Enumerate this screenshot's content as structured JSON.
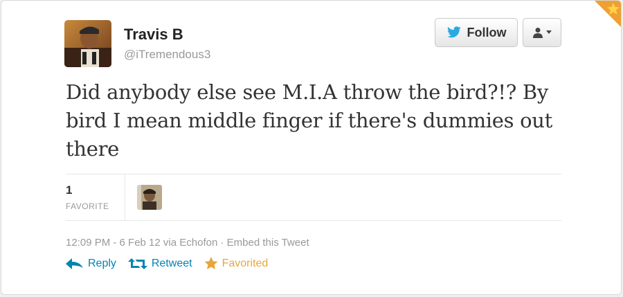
{
  "tweet": {
    "author_name": "Travis B",
    "author_handle": "@iTremendous3",
    "text": "Did anybody else see M.I.A throw the bird?!? By bird I mean middle finger if there's dummies out there",
    "favorite_count": "1",
    "favorite_label": "FAVORITE",
    "time": "12:09 PM - 6 Feb 12",
    "via": "via Echofon",
    "separator": "·",
    "embed_label": "Embed this Tweet"
  },
  "buttons": {
    "follow_label": "Follow"
  },
  "actions": {
    "reply_label": "Reply",
    "retweet_label": "Retweet",
    "favorited_label": "Favorited"
  },
  "colors": {
    "link_blue": "#0084b4",
    "favorite_gold": "#e8a63a",
    "twitter_bird_blue": "#2aa9e0"
  },
  "icons": {
    "follow": "bird-icon",
    "user_menu": "person-icon",
    "reply": "reply-arrow-icon",
    "retweet": "retweet-icon",
    "favorite": "star-icon"
  }
}
